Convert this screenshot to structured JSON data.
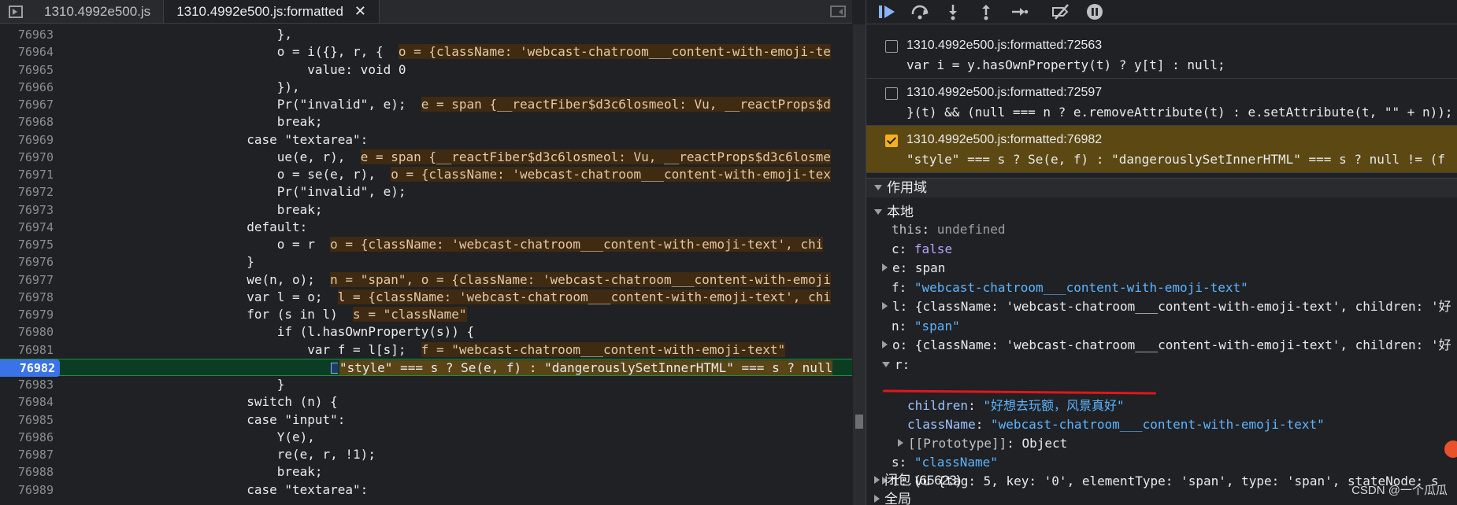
{
  "tabs": [
    {
      "label": "1310.4992e500.js",
      "active": false
    },
    {
      "label": "1310.4992e500.js:formatted",
      "active": true
    }
  ],
  "tab_close_glyph": "✕",
  "code_lines": [
    {
      "n": "76963",
      "t": "                            },"
    },
    {
      "n": "76964",
      "t": "                            o = i({}, r, {  ",
      "inline": "o = {className: 'webcast-chatroom___content-with-emoji-te"
    },
    {
      "n": "76965",
      "t": "                                value: void 0"
    },
    {
      "n": "76966",
      "t": "                            }),"
    },
    {
      "n": "76967",
      "t": "                            Pr(\"invalid\", e);  ",
      "inline": "e = span {__reactFiber$d3c6losmeol: Vu, __reactProps$d"
    },
    {
      "n": "76968",
      "t": "                            break;"
    },
    {
      "n": "76969",
      "t": "                        case \"textarea\":"
    },
    {
      "n": "76970",
      "t": "                            ue(e, r),  ",
      "inline": "e = span {__reactFiber$d3c6losmeol: Vu, __reactProps$d3c6losme"
    },
    {
      "n": "76971",
      "t": "                            o = se(e, r),  ",
      "inline": "o = {className: 'webcast-chatroom___content-with-emoji-tex"
    },
    {
      "n": "76972",
      "t": "                            Pr(\"invalid\", e);"
    },
    {
      "n": "76973",
      "t": "                            break;"
    },
    {
      "n": "76974",
      "t": "                        default:"
    },
    {
      "n": "76975",
      "t": "                            o = r  ",
      "inline": "o = {className: 'webcast-chatroom___content-with-emoji-text', chi"
    },
    {
      "n": "76976",
      "t": "                        }"
    },
    {
      "n": "76977",
      "t": "                        we(n, o);  ",
      "inline": "n = \"span\", o = {className: 'webcast-chatroom___content-with-emoji"
    },
    {
      "n": "76978",
      "t": "                        var l = o;  ",
      "inline": "l = {className: 'webcast-chatroom___content-with-emoji-text', chi"
    },
    {
      "n": "76979",
      "t": "                        for (s in l)  ",
      "inline": "s = \"className\""
    },
    {
      "n": "76980",
      "t": "                            if (l.hasOwnProperty(s)) {"
    },
    {
      "n": "76981",
      "t": "                                var f = l[s];  ",
      "inline": "f = \"webcast-chatroom___content-with-emoji-text\""
    },
    {
      "n": "76982",
      "t": "\"style\" === s ? Se(e, f) : \"dangerouslySetInnerHTML\" === s ? null",
      "current": true
    },
    {
      "n": "76983",
      "t": "                            }"
    },
    {
      "n": "76984",
      "t": "                        switch (n) {"
    },
    {
      "n": "76985",
      "t": "                        case \"input\":"
    },
    {
      "n": "76986",
      "t": "                            Y(e),"
    },
    {
      "n": "76987",
      "t": "                            re(e, r, !1);"
    },
    {
      "n": "76988",
      "t": "                            break;"
    },
    {
      "n": "76989",
      "t": "                        case \"textarea\":"
    }
  ],
  "breakpoints": [
    {
      "file": "1310.4992e500.js:formatted:72563",
      "code": "var i = y.hasOwnProperty(t) ? y[t] : null;",
      "checked": false
    },
    {
      "file": "1310.4992e500.js:formatted:72597",
      "code": "}(t) && (null === n ? e.removeAttribute(t) : e.setAttribute(t, \"\" + n));",
      "checked": false
    },
    {
      "file": "1310.4992e500.js:formatted:76982",
      "code": "\"style\" === s ? Se(e, f) : \"dangerouslySetInnerHTML\" === s ? null != (f",
      "checked": true
    }
  ],
  "scope": {
    "title": "作用域",
    "local_title": "本地",
    "vars": [
      {
        "name": "this",
        "value": "undefined",
        "kind": "undef",
        "expand": false
      },
      {
        "name": "c",
        "value": "false",
        "kind": "kw",
        "expand": false
      },
      {
        "name": "e",
        "value": "span",
        "kind": "plain",
        "expand": true
      },
      {
        "name": "f",
        "value": "\"webcast-chatroom___content-with-emoji-text\"",
        "kind": "str",
        "expand": false
      },
      {
        "name": "l",
        "value": "{className: 'webcast-chatroom___content-with-emoji-text', children: '好",
        "kind": "plain",
        "expand": true
      },
      {
        "name": "n",
        "value": "\"span\"",
        "kind": "str",
        "expand": false
      },
      {
        "name": "o",
        "value": "{className: 'webcast-chatroom___content-with-emoji-text', children: '好",
        "kind": "plain",
        "expand": true
      },
      {
        "name": "r",
        "value": "",
        "kind": "plain",
        "expand": "open"
      }
    ],
    "r_children": {
      "name": "children",
      "value": "\"好想去玩额，风景真好\""
    },
    "r_classname": {
      "name": "className",
      "value": "\"webcast-chatroom___content-with-emoji-text\""
    },
    "r_proto": {
      "name": "[[Prototype]]",
      "value": "Object"
    },
    "s_var": {
      "name": "s",
      "value": "\"className\""
    },
    "t_var": {
      "name": "t",
      "value": "Vu {tag: 5, key: '0', elementType: 'span', type: 'span', stateNode: s"
    },
    "closure": "闭包 (65623)",
    "global": "全局"
  },
  "watermark": "CSDN @一个瓜瓜",
  "colors": {
    "current_line": "#0b3d25",
    "bp_active": "#5c4813",
    "underline": "#e1161b"
  }
}
